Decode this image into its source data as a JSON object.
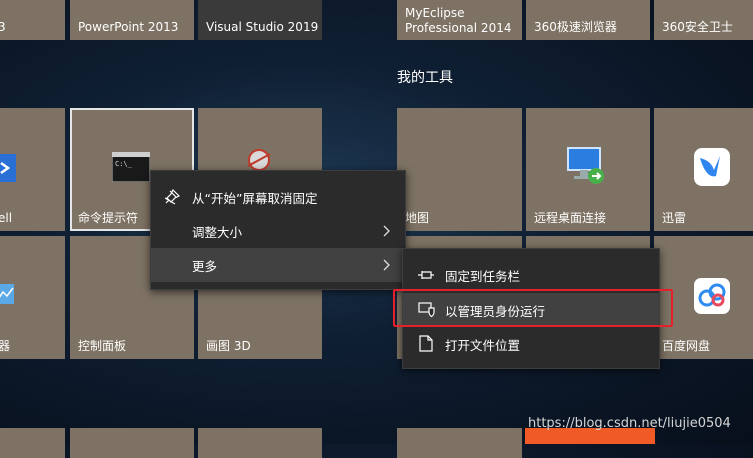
{
  "tiles_top": [
    {
      "label": "3"
    },
    {
      "label": "PowerPoint 2013"
    },
    {
      "label": "Visual Studio 2019"
    },
    {
      "label": "MyEclipse\nProfessional 2014"
    },
    {
      "label": "360极速浏览器"
    },
    {
      "label": "360安全卫士"
    }
  ],
  "group_title": "我的工具",
  "tiles_mid": [
    {
      "label": "ell"
    },
    {
      "label": "命令提示符"
    },
    {
      "label": "地图"
    },
    {
      "label": "远程桌面连接"
    },
    {
      "label": "迅雷"
    }
  ],
  "tiles_low": [
    {
      "label": "器"
    },
    {
      "label": "控制面板"
    },
    {
      "label": "画图 3D"
    },
    {
      "label": "百度网盘"
    }
  ],
  "context_menu": {
    "items": [
      {
        "label": "从“开始”屏幕取消固定"
      },
      {
        "label": "调整大小"
      },
      {
        "label": "更多"
      }
    ]
  },
  "sub_menu": {
    "items": [
      {
        "label": "固定到任务栏"
      },
      {
        "label": "以管理员身份运行"
      },
      {
        "label": "打开文件位置"
      }
    ]
  },
  "watermark": "https://blog.csdn.net/liujie0504",
  "colors": {
    "tile": "#7d7263",
    "menu": "#2b2b2b",
    "highlight": "#e5202b"
  }
}
